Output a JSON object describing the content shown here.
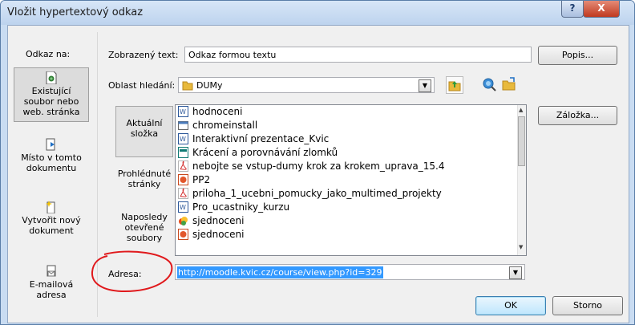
{
  "window": {
    "title": "Vložit hypertextový odkaz",
    "help": "?",
    "close": "X"
  },
  "link_to": {
    "label": "Odkaz na:",
    "items": [
      {
        "line1": "Existující",
        "line2": "soubor nebo",
        "line3": "web. stránka",
        "icon": "existing-file-icon"
      },
      {
        "line1": "Místo v tomto",
        "line2": "dokumentu",
        "icon": "place-in-document-icon"
      },
      {
        "line1": "Vytvořit nový",
        "line2": "dokument",
        "icon": "new-document-icon"
      },
      {
        "line1": "E-mailová",
        "line2": "adresa",
        "icon": "email-icon"
      }
    ]
  },
  "display_text": {
    "label": "Zobrazený text:",
    "value": "Odkaz formou textu",
    "button": "Popis..."
  },
  "look_in": {
    "label": "Oblast hledání:",
    "value": "DUMy"
  },
  "nav": {
    "current_folder": {
      "line1": "Aktuální",
      "line2": "složka"
    },
    "browsed_pages": {
      "line1": "Prohlédnuté",
      "line2": "stránky"
    },
    "recent_files": {
      "line1": "Naposledy",
      "line2": "otevřené",
      "line3": "soubory"
    }
  },
  "files": [
    {
      "name": "hodnoceni",
      "type": "word"
    },
    {
      "name": "chromeinstall",
      "type": "exe"
    },
    {
      "name": "Interaktivní prezentace_Kvic",
      "type": "word"
    },
    {
      "name": "Krácení a porovnávání zlomků",
      "type": "pub"
    },
    {
      "name": "nebojte se vstup-dumy krok za krokem_uprava_15.4",
      "type": "pdf"
    },
    {
      "name": "PP2",
      "type": "ppt"
    },
    {
      "name": "priloha_1_ucebni_pomucky_jako_multimed_projekty",
      "type": "pdf"
    },
    {
      "name": "Pro_ucastniky_kurzu",
      "type": "word"
    },
    {
      "name": "sjednoceni",
      "type": "smart"
    },
    {
      "name": "sjednoceni",
      "type": "ppt"
    }
  ],
  "bookmark_button": "Záložka...",
  "address": {
    "label": "Adresa:",
    "value": "http://moodle.kvic.cz/course/view.php?id=329"
  },
  "ok_button": "OK",
  "cancel_button": "Storno",
  "colors": {
    "selection": "#3399ff",
    "annotation": "#e0191c",
    "titlebar": "#c9dcf2"
  }
}
